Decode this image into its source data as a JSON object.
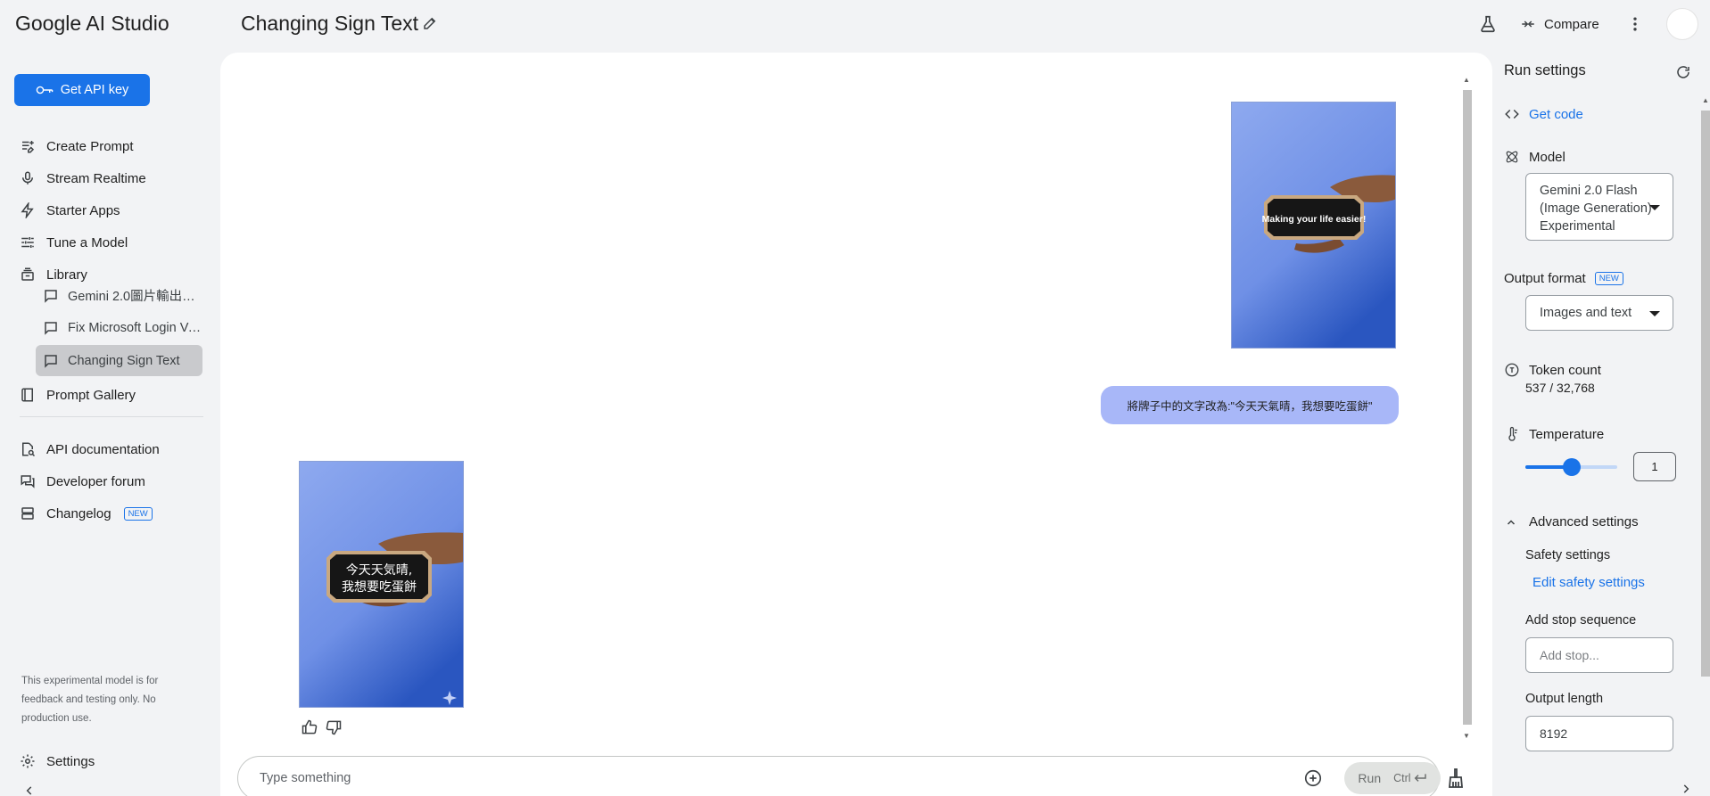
{
  "header": {
    "brand": "Google AI Studio",
    "doc_title": "Changing Sign Text",
    "compare_label": "Compare"
  },
  "sidebar": {
    "api_key_label": "Get API key",
    "items": [
      {
        "label": "Create Prompt",
        "icon": "create-prompt-icon"
      },
      {
        "label": "Stream Realtime",
        "icon": "microphone-icon"
      },
      {
        "label": "Starter Apps",
        "icon": "bolt-icon"
      },
      {
        "label": "Tune a Model",
        "icon": "tune-icon"
      },
      {
        "label": "Library",
        "icon": "library-icon"
      }
    ],
    "library_items": [
      {
        "label": "Gemini 2.0圖片輸出功...",
        "active": false
      },
      {
        "label": "Fix Microsoft Login Ve...",
        "active": false
      },
      {
        "label": "Changing Sign Text",
        "active": true
      }
    ],
    "prompt_gallery": "Prompt Gallery",
    "api_docs": "API documentation",
    "dev_forum": "Developer forum",
    "changelog": "Changelog",
    "new_badge": "NEW",
    "disclaimer": "This experimental model is for feedback and testing only. No production use.",
    "settings_label": "Settings"
  },
  "chat": {
    "user_image_sign_text": "Making your life easier!",
    "user_message": "將牌子中的文字改為:\"今天天氣晴，我想要吃蛋餅\"",
    "model_image_sign_line1": "今天天気晴,",
    "model_image_sign_line2": "我想要吃蛋餅",
    "composer_placeholder": "Type something",
    "run_label": "Run",
    "run_shortcut": "Ctrl"
  },
  "run_settings": {
    "title": "Run settings",
    "get_code": "Get code",
    "model_label": "Model",
    "model_value_line1": "Gemini 2.0 Flash",
    "model_value_line2": "(Image Generation)",
    "model_value_line3": "Experimental",
    "output_format_label": "Output format",
    "new_badge": "NEW",
    "output_format_value": "Images and text",
    "token_count_label": "Token count",
    "token_count_value": "537 / 32,768",
    "temperature_label": "Temperature",
    "temperature_value": "1",
    "temperature_fraction": 0.5,
    "advanced_label": "Advanced settings",
    "safety_label": "Safety settings",
    "edit_safety": "Edit safety settings",
    "stop_label": "Add stop sequence",
    "stop_placeholder": "Add stop...",
    "output_length_label": "Output length",
    "output_length_value": "8192"
  },
  "colors": {
    "accent": "#1a73e8",
    "user_bubble": "#a8b7f8",
    "active_item": "#c9cacd"
  }
}
